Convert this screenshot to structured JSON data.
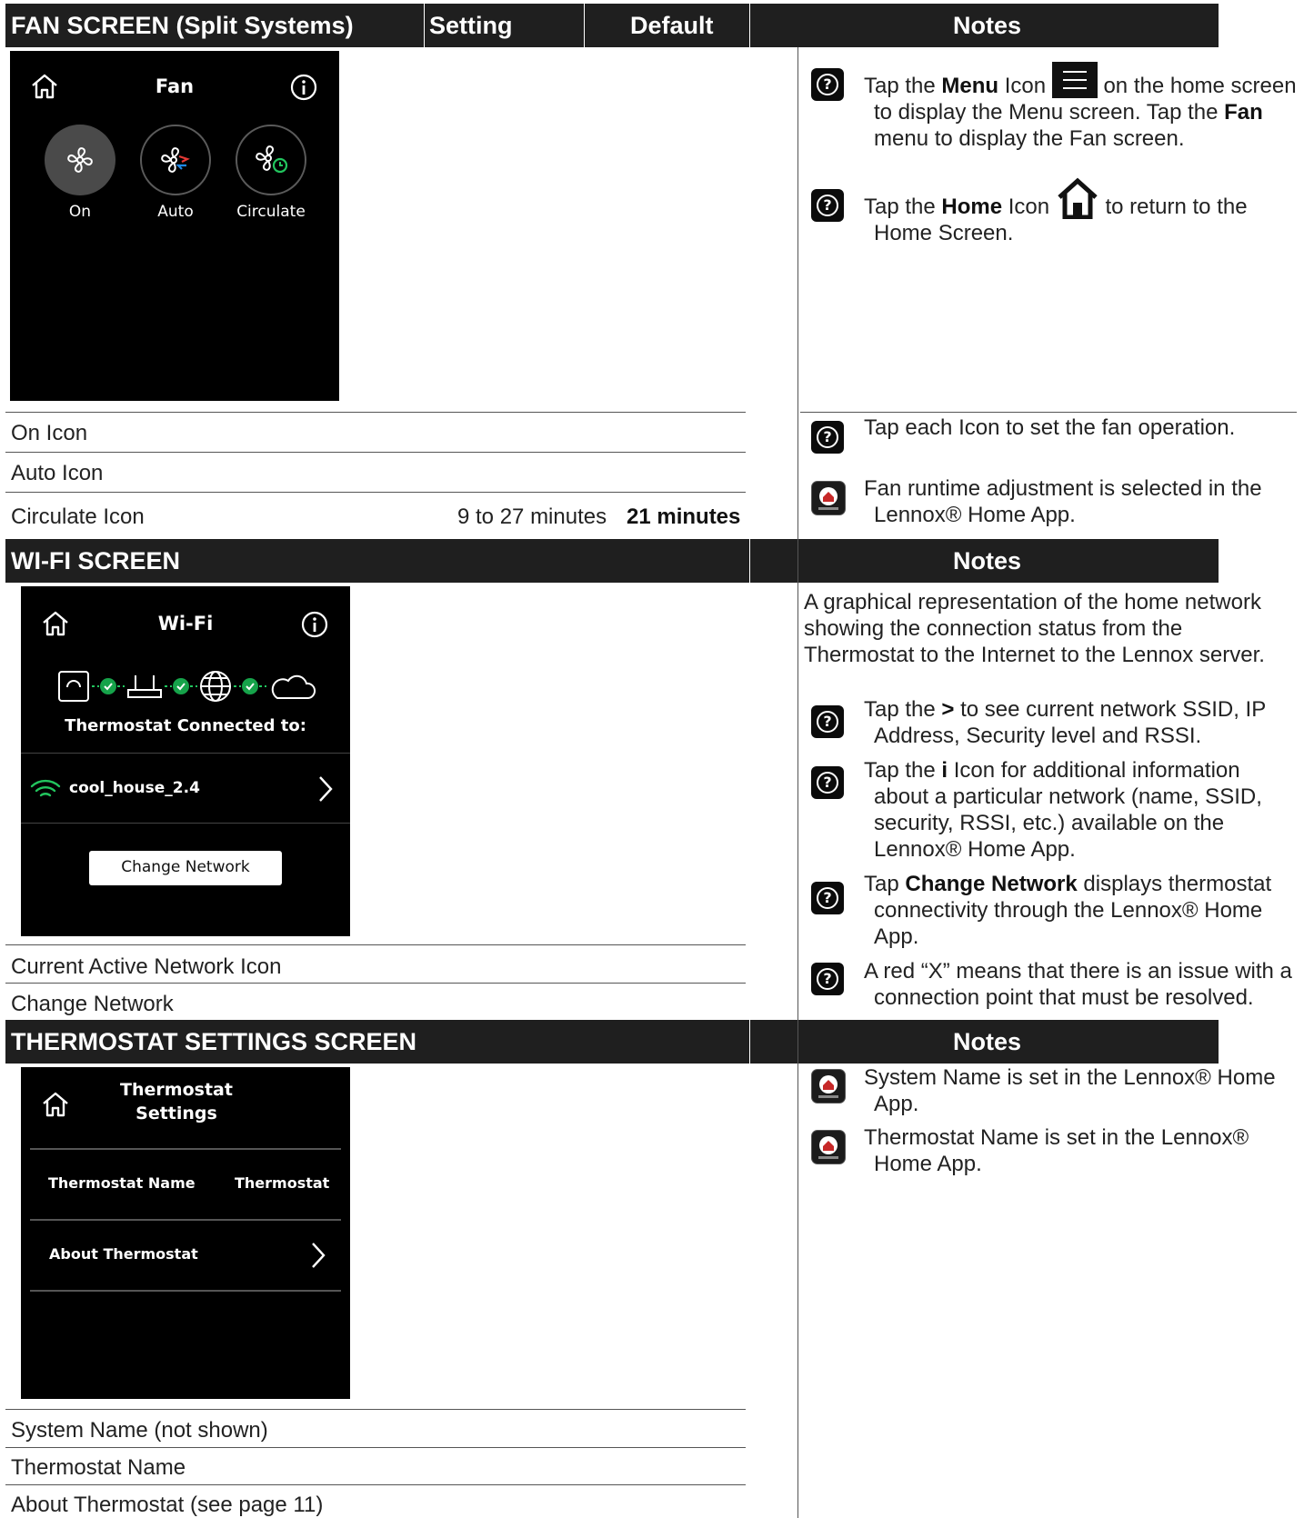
{
  "fan_section": {
    "header_title": "FAN SCREEN (Split Systems)",
    "col_setting": "Setting",
    "col_default": "Default",
    "col_notes": "Notes",
    "screen": {
      "title": "Fan",
      "btn_on": "On",
      "btn_auto": "Auto",
      "btn_circulate": "Circulate"
    },
    "rows": {
      "on_icon": "On Icon",
      "auto_icon": "Auto Icon",
      "circulate_icon": "Circulate Icon",
      "circulate_setting": "9 to 27 minutes",
      "circulate_default": "21 minutes"
    },
    "notes": {
      "n1_a": "Tap the ",
      "n1_b": "Menu",
      "n1_c": " Icon ",
      "n1_d": " on the home screen",
      "n1_e": "to display the Menu screen. Tap the ",
      "n1_f": "Fan",
      "n1_g": "menu to display the Fan screen.",
      "n2_a": "Tap the ",
      "n2_b": "Home",
      "n2_c": " Icon ",
      "n2_d": " to return to the",
      "n2_e": "Home Screen.",
      "n3": "Tap each Icon to set the fan operation.",
      "n4_a": "Fan runtime adjustment is selected in the",
      "n4_b": "Lennox® Home App."
    }
  },
  "wifi_section": {
    "header_title": "WI-FI SCREEN",
    "col_notes": "Notes",
    "screen": {
      "title": "Wi-Fi",
      "connected_label": "Thermostat Connected to:",
      "network_name": "cool_house_2.4",
      "change_button": "Change Network"
    },
    "rows": {
      "current_active": "Current Active Network Icon",
      "change_network": "Change Network"
    },
    "notes": {
      "intro_1": "A graphical representation of the home network",
      "intro_2": "showing the connection status from the",
      "intro_3": "Thermostat to the Internet to the Lennox server.",
      "n1_a": "Tap the ",
      "n1_b": ">",
      "n1_c": " to see current network SSID, IP",
      "n1_d": "Address, Security level and RSSI.",
      "n2_a": "Tap the ",
      "n2_b": "i",
      "n2_c": " Icon for additional information",
      "n2_d": "about a particular network (name, SSID,",
      "n2_e": "security, RSSI, etc.) available on the",
      "n2_f": "Lennox® Home App.",
      "n3_a": "Tap ",
      "n3_b": "Change Network",
      "n3_c": " displays thermostat",
      "n3_d": "connectivity through the Lennox® Home",
      "n3_e": "App.",
      "n4_a": "A red “X” means that there is an issue with a",
      "n4_b": "connection point that must be resolved."
    }
  },
  "thermostat_section": {
    "header_title": "THERMOSTAT SETTINGS SCREEN",
    "col_notes": "Notes",
    "screen": {
      "title_1": "Thermostat",
      "title_2": "Settings",
      "name_label": "Thermostat Name",
      "name_value": "Thermostat",
      "about_label": "About Thermostat"
    },
    "rows": {
      "system_name": "System Name (not shown)",
      "thermostat_name": "Thermostat Name",
      "about": "About Thermostat (see page 11)"
    },
    "notes": {
      "n1_a": "System Name is set in the Lennox® Home",
      "n1_b": "App.",
      "n2_a": "Thermostat Name is set in the Lennox®",
      "n2_b": "Home App."
    }
  },
  "icons": [
    "home-icon",
    "info-icon",
    "fan-icon",
    "question-icon",
    "lennox-app-icon",
    "menu-icon",
    "wifi-icon",
    "router-icon",
    "globe-icon",
    "cloud-icon",
    "check-icon",
    "chevron-right-icon"
  ],
  "colors": {
    "header_bg": "#1f1f1f",
    "screen_bg": "#000000",
    "wifi_green": "#22c55e",
    "check_green": "#16a34a"
  }
}
